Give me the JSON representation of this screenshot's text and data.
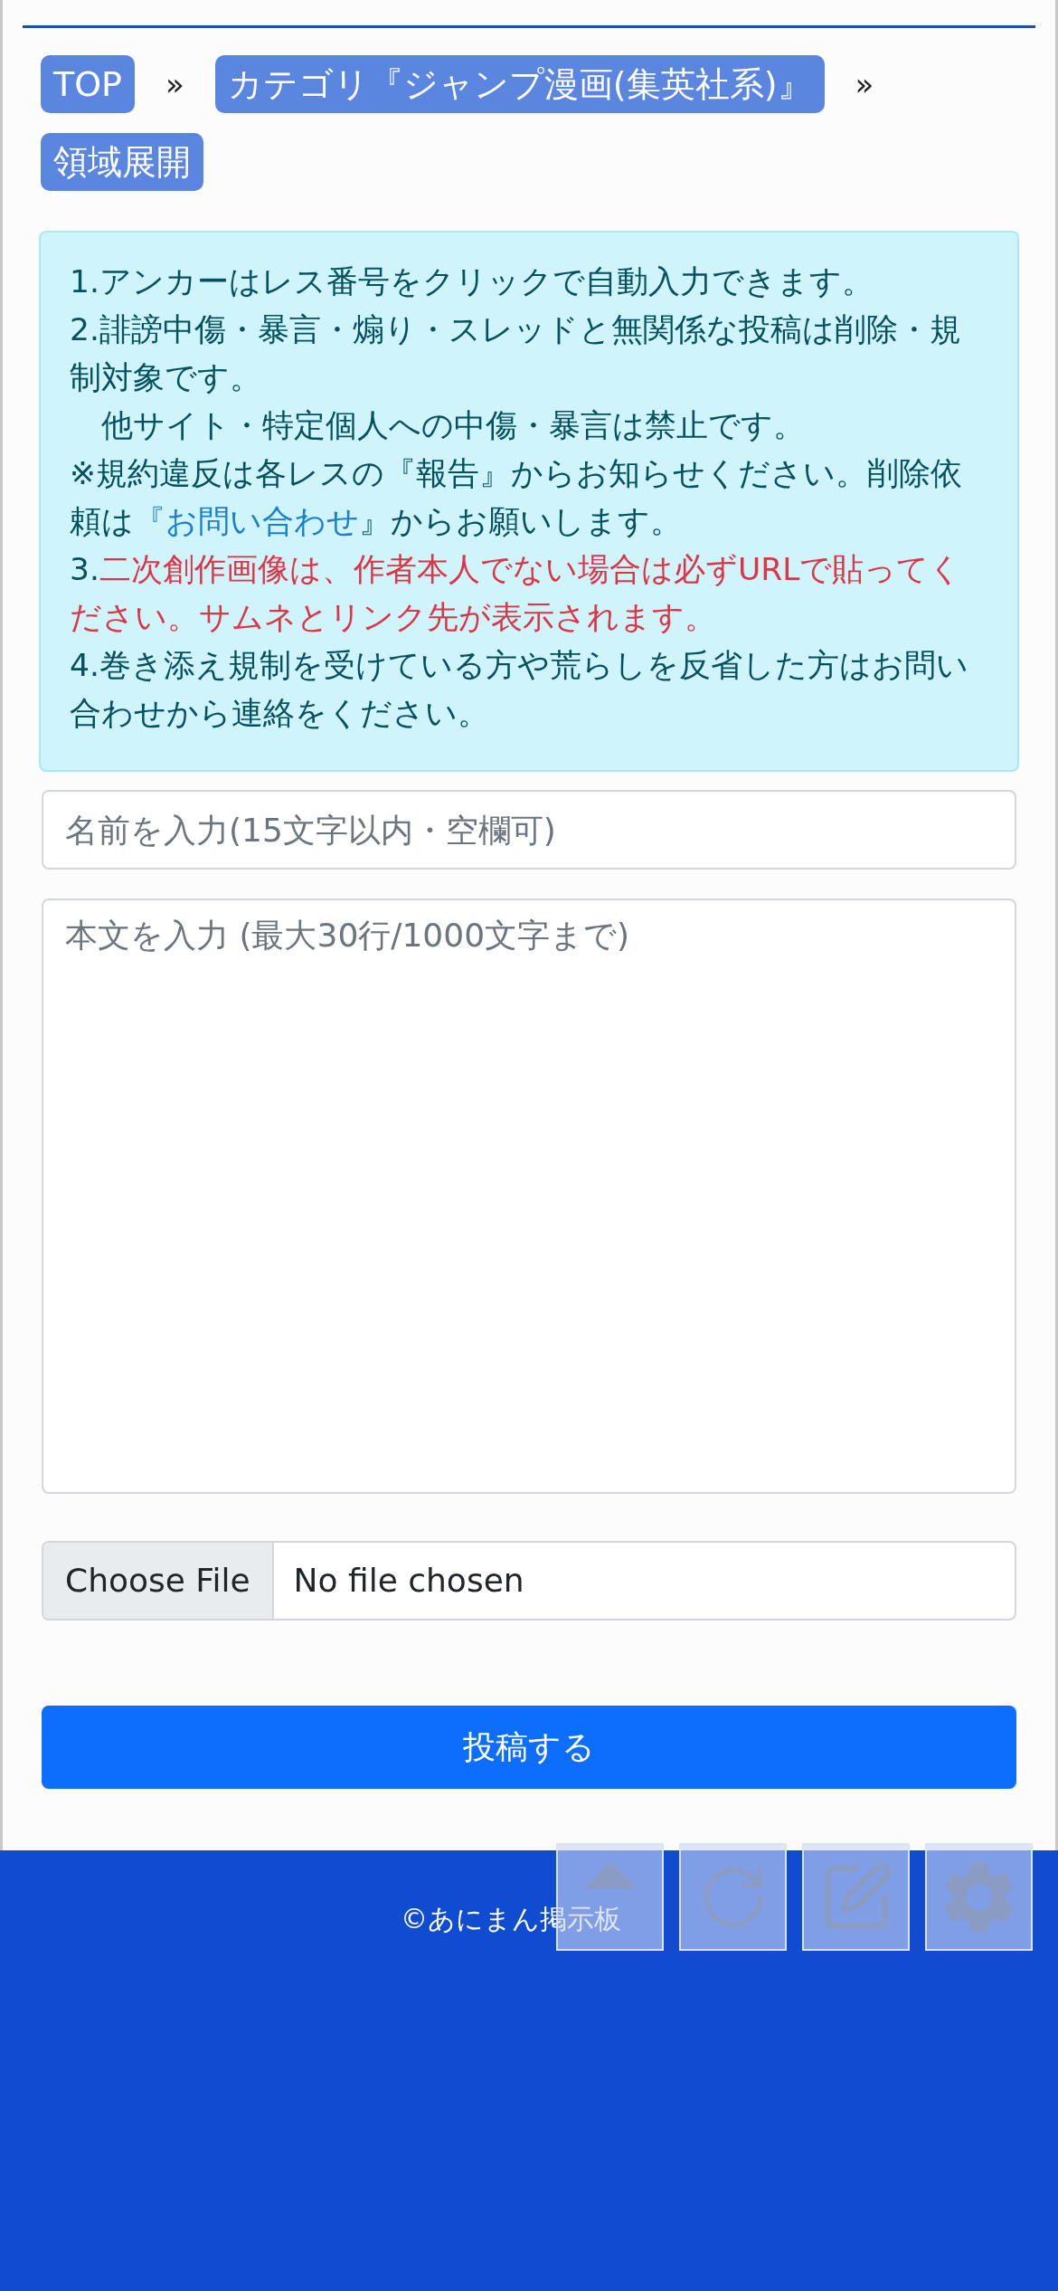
{
  "breadcrumbs": [
    {
      "label": "TOP",
      "separator_after": "»"
    },
    {
      "label": "カテゴリ『ジャンプ漫画(集英社系)』",
      "separator_after": "»"
    },
    {
      "label": "領域展開"
    }
  ],
  "notice": [
    [
      {
        "kind": "plain",
        "text": "1.アンカーはレス番号をクリックで自動入力できます。"
      }
    ],
    [
      {
        "kind": "plain",
        "text": "2.誹謗中傷・暴言・煽り・スレッドと無関係な投稿は削除・規制対象です。"
      }
    ],
    [
      {
        "kind": "plain",
        "text": "　他サイト・特定個人への中傷・暴言は禁止です。"
      }
    ],
    [
      {
        "kind": "plain",
        "text": "※規約違反は各レスの『報告』からお知らせください。削除依頼は"
      },
      {
        "kind": "link",
        "text": "『お問い合わせ"
      },
      {
        "kind": "plain",
        "text": "』からお願いします。"
      }
    ],
    [
      {
        "kind": "plain",
        "text": "3."
      },
      {
        "kind": "warning",
        "text": "二次創作画像は、作者本人でない場合は必ずURLで貼ってください。サムネとリンク先が表示されます。"
      }
    ],
    [
      {
        "kind": "plain",
        "text": "4.巻き添え規制を受けている方や荒らしを反省した方はお問い合わせから連絡をください。"
      }
    ]
  ],
  "form": {
    "name_field": {
      "placeholder": "名前を入力(15文字以内・空欄可)"
    },
    "body_field": {
      "placeholder": "本文を入力 (最大30行/1000文字まで)"
    },
    "file_button": "Choose File",
    "file_status": "No file chosen",
    "submit": "投稿する"
  },
  "footer": {
    "copyright": "©あにまん掲示板"
  },
  "floating_buttons": [
    {
      "kind": "up"
    },
    {
      "kind": "reload"
    },
    {
      "kind": "edit"
    },
    {
      "kind": "settings"
    }
  ]
}
